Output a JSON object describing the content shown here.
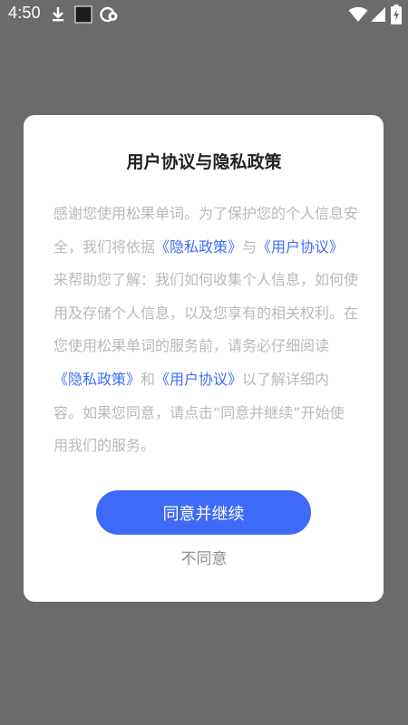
{
  "status_bar": {
    "time": "4:50",
    "icons": [
      "download-icon",
      "square-notification-icon",
      "app-notification-icon",
      "wifi-icon",
      "signal-icon",
      "battery-charging-icon"
    ]
  },
  "dialog": {
    "title": "用户协议与隐私政策",
    "body": {
      "t1": "感谢您使用松果单词。为了保护您的个人信息安全，我们将依据",
      "link_privacy_1": "《隐私政策》",
      "t2": "与",
      "link_agreement_1": "《用户协议》",
      "t3": "来帮助您了解：我们如何收集个人信息，如何使用及存储个人信息，以及您享有的相关权利。在您使用松果单词的服务前，请务必仔细阅读",
      "link_privacy_2": "《隐私政策》",
      "t4": "和",
      "link_agreement_2": "《用户协议》",
      "t5": "以了解详细内容。如果您同意，请点击“同意并继续”开始使用我们的服务。"
    },
    "agree_label": "同意并继续",
    "decline_label": "不同意"
  },
  "colors": {
    "overlay": "#6b6b6b",
    "accent": "#3d6af6",
    "link": "#3f6df2",
    "body_text": "#b9b9b9"
  }
}
